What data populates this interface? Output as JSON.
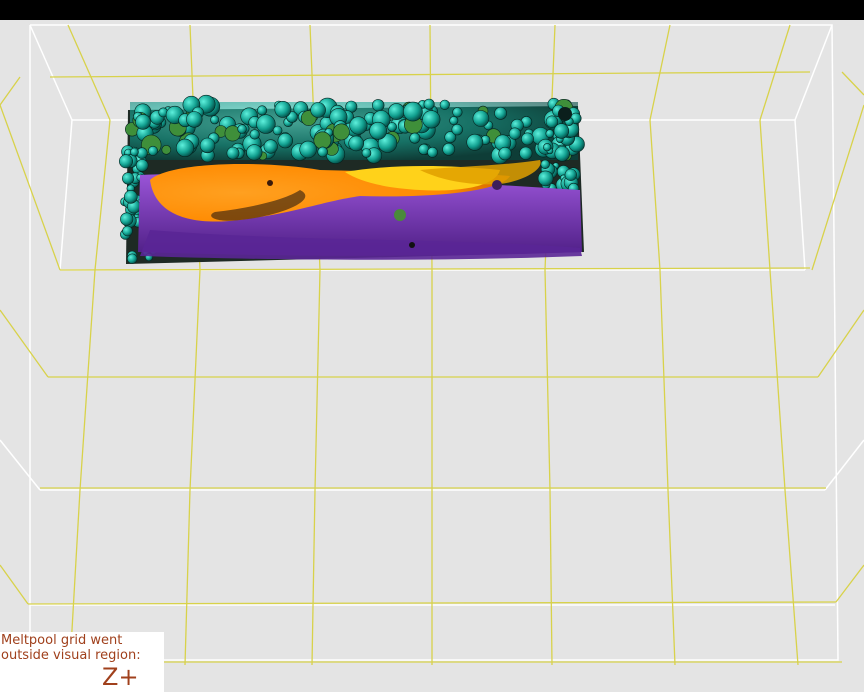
{
  "window": {
    "top_bar_color": "#000000",
    "background_color": "#e4e4e4"
  },
  "scene": {
    "grid_colors": {
      "inner": "#d8d24a",
      "outer": "#ffffff"
    },
    "meltpool_colors": {
      "orange": "#ff8c00",
      "purple": "#7a2fb8",
      "teal": "#1fb3a0",
      "yellow": "#ffd700"
    }
  },
  "status": {
    "warning_text": "Meltpool grid went\noutside visual region:",
    "axis": "Z+",
    "text_color": "#a0401c"
  }
}
